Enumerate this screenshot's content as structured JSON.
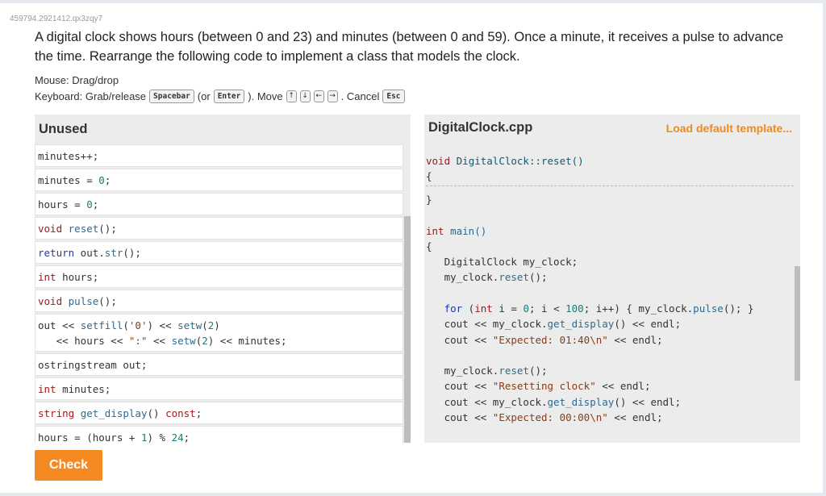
{
  "uid": "459794.2921412.qx3zqy7",
  "prompt": "A digital clock shows hours (between 0 and 23) and minutes (between 0 and 59). Once a minute, it receives a pulse to advance the time. Rearrange the following code to implement a class that models the clock.",
  "instructions": {
    "mouse": "Mouse: Drag/drop",
    "keyboard_prefix": "Keyboard: Grab/release",
    "key_spacebar": "Spacebar",
    "or_text": "(or",
    "key_enter": "Enter",
    "move_text": "). Move",
    "arrow_up": "↑",
    "arrow_down": "↓",
    "arrow_left": "←",
    "arrow_right": "→",
    "cancel_text": ". Cancel",
    "key_esc": "Esc"
  },
  "unused": {
    "title": "Unused",
    "blocks": [
      [
        "minutes++;"
      ],
      [
        "minutes = 0;"
      ],
      [
        "hours = 0;"
      ],
      [
        "void reset();"
      ],
      [
        "return out.str();"
      ],
      [
        "int hours;"
      ],
      [
        "void pulse();"
      ],
      [
        "out << setfill('0') << setw(2)",
        "   << hours << \":\" << setw(2) << minutes;"
      ],
      [
        "ostringstream out;"
      ],
      [
        "int minutes;"
      ],
      [
        "string get_display() const;"
      ],
      [
        "hours = (hours + 1) % 24;"
      ]
    ]
  },
  "file": {
    "name": "DigitalClock.cpp",
    "load_template": "Load default template...",
    "reset_sig": "void DigitalClock::reset()",
    "open_brace": "{",
    "close_brace": "}",
    "main_sig": "int main()",
    "main_open": "{",
    "main_lines": [
      "   DigitalClock my_clock;",
      "   my_clock.reset();",
      "",
      "   for (int i = 0; i < 100; i++) { my_clock.pulse(); }",
      "   cout << my_clock.get_display() << endl;",
      "   cout << \"Expected: 01:40\\n\" << endl;",
      "",
      "   my_clock.reset();",
      "   cout << \"Resetting clock\" << endl;",
      "   cout << my_clock.get_display() << endl;",
      "   cout << \"Expected: 00:00\\n\" << endl;"
    ]
  },
  "check_button": "Check",
  "colors": {
    "accent": "#f58a23",
    "keyword": "#a0191d",
    "function": "#2d6b8f",
    "number": "#1a7d73",
    "string": "#8a3c10"
  }
}
